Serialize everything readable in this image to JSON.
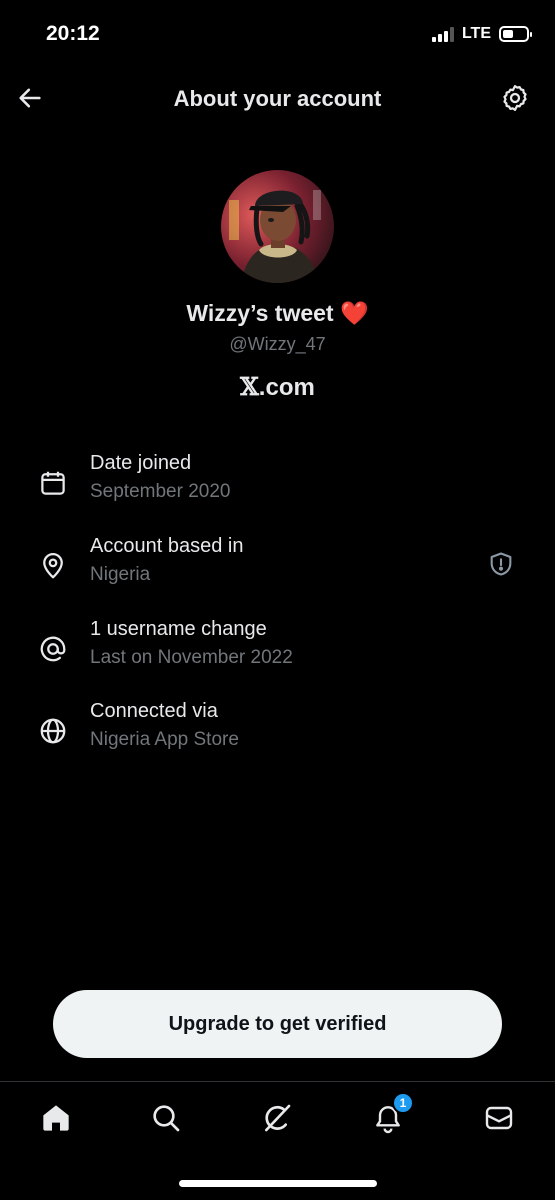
{
  "status_bar": {
    "time": "20:12",
    "network": "LTE",
    "battery_level_percent": 45
  },
  "header": {
    "title": "About your account",
    "back_icon": "arrow-left-icon",
    "settings_icon": "gear-icon"
  },
  "profile": {
    "display_name": "Wizzy’s tweet",
    "emoji": "❤️",
    "handle": "@Wizzy_47",
    "brand_x": "𝕏",
    "brand_suffix": ".com"
  },
  "info": [
    {
      "icon": "calendar-icon",
      "label": "Date joined",
      "value": "September 2020"
    },
    {
      "icon": "location-pin-icon",
      "label": "Account based in",
      "value": "Nigeria"
    },
    {
      "icon": "at-sign-icon",
      "label": "1 username change",
      "value": "Last on November 2022"
    },
    {
      "icon": "globe-icon",
      "label": "Connected via",
      "value": "Nigeria App Store"
    }
  ],
  "upgrade_button": {
    "label": "Upgrade to get verified"
  },
  "nav": {
    "items": [
      "home-icon",
      "search-icon",
      "grok-icon",
      "bell-icon",
      "mail-icon"
    ],
    "notification_badge": "1"
  },
  "colors": {
    "background": "#000000",
    "primary_text": "#e7e9ea",
    "secondary_text": "#71767b",
    "accent_blue": "#1d9bf0",
    "button_bg": "#eff3f4"
  }
}
